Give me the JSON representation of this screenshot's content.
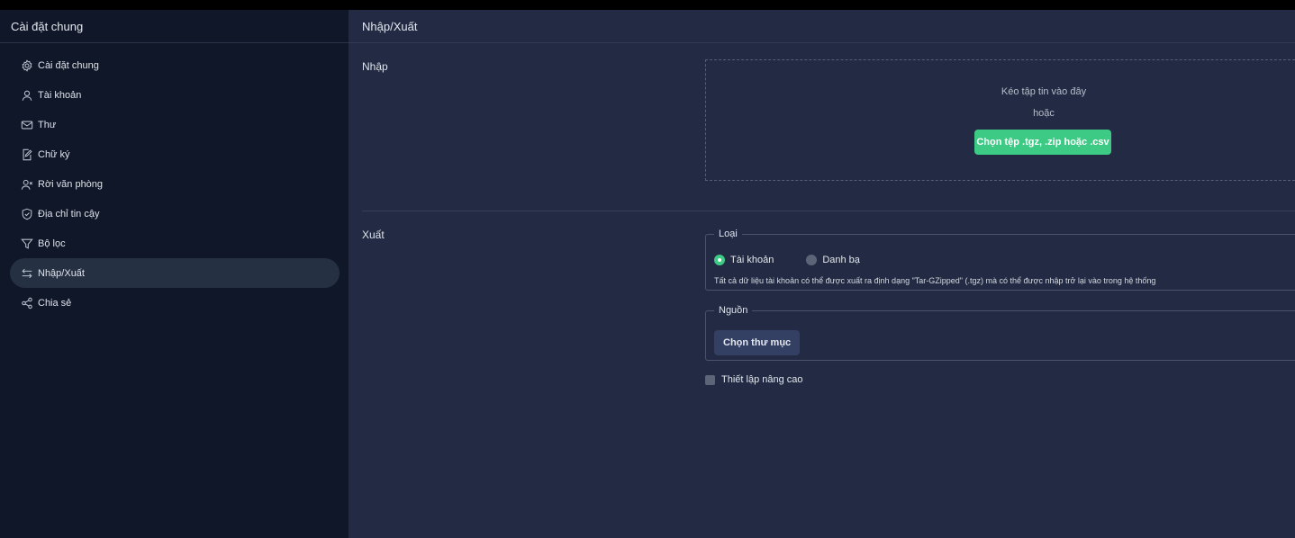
{
  "sidebar": {
    "title": "Cài đặt chung",
    "items": [
      {
        "label": "Cài đặt chung",
        "icon": "gear-icon"
      },
      {
        "label": "Tài khoản",
        "icon": "user-icon"
      },
      {
        "label": "Thư",
        "icon": "mail-icon"
      },
      {
        "label": "Chữ ký",
        "icon": "signature-icon"
      },
      {
        "label": "Rời văn phòng",
        "icon": "user-away-icon"
      },
      {
        "label": "Địa chỉ tin cậy",
        "icon": "shield-icon"
      },
      {
        "label": "Bộ lọc",
        "icon": "filter-icon"
      },
      {
        "label": "Nhập/Xuất",
        "icon": "transfer-icon",
        "active": true
      },
      {
        "label": "Chia sẻ",
        "icon": "share-icon"
      }
    ]
  },
  "main": {
    "title": "Nhập/Xuất",
    "import": {
      "label": "Nhập",
      "drop_text": "Kéo tập tin vào đây",
      "or_text": "hoặc",
      "button": "Chọn tệp .tgz, .zip hoặc .csv"
    },
    "export": {
      "label": "Xuất",
      "type_legend": "Loại",
      "options": [
        "Tài khoản",
        "Danh bạ"
      ],
      "selected": "Tài khoản",
      "description": "Tất cả dữ liệu tài khoản có thể được xuất ra định dạng \"Tar-GZipped\" (.tgz) mà có thể được nhập trở lại vào trong hệ thống",
      "source_legend": "Nguồn",
      "folder_button": "Chọn thư mục",
      "advanced_label": "Thiết lập nâng cao"
    }
  },
  "colors": {
    "accent": "#3dca84",
    "sidebar_bg": "#0f1729",
    "main_bg": "#222b43"
  }
}
